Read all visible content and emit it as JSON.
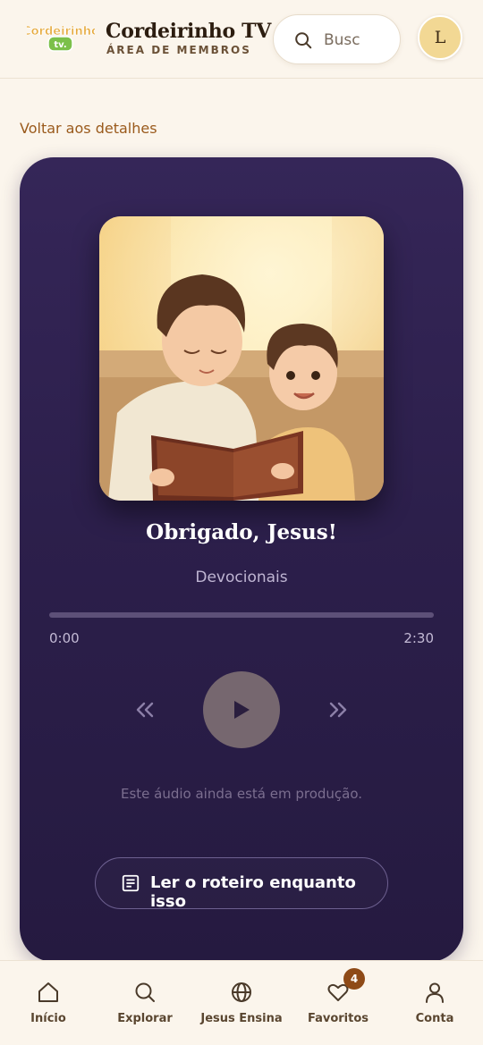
{
  "header": {
    "logo_text": "Cordeirinho tv",
    "title": "Cordeirinho TV",
    "subtitle": "ÁREA DE MEMBROS",
    "search_placeholder": "Busc",
    "avatar_initial": "L"
  },
  "back_link": "Voltar aos detalhes",
  "player": {
    "cover_icon": "illustration-two-children-reading-book",
    "title": "Obrigado, Jesus!",
    "category": "Devocionais",
    "progress_fraction": 0,
    "time_current": "0:00",
    "time_total": "2:30",
    "controls": {
      "rewind_icon": "double-chevron-left-icon",
      "play_icon": "play-icon",
      "forward_icon": "double-chevron-right-icon"
    },
    "note": "Este áudio ainda está em produção.",
    "script_button": "Ler o roteiro enquanto isso"
  },
  "bottom_nav": {
    "items": [
      {
        "label": "Início",
        "icon": "home-icon"
      },
      {
        "label": "Explorar",
        "icon": "search-icon"
      },
      {
        "label": "Jesus Ensina",
        "icon": "globe-icon"
      },
      {
        "label": "Favoritos",
        "icon": "heart-icon"
      },
      {
        "label": "Conta",
        "icon": "user-icon"
      }
    ],
    "favorites_badge": "4"
  },
  "colors": {
    "background": "#fbf5ec",
    "card": "#2c1f4b",
    "accent": "#9a5a1c",
    "badge": "#8e4a17"
  }
}
